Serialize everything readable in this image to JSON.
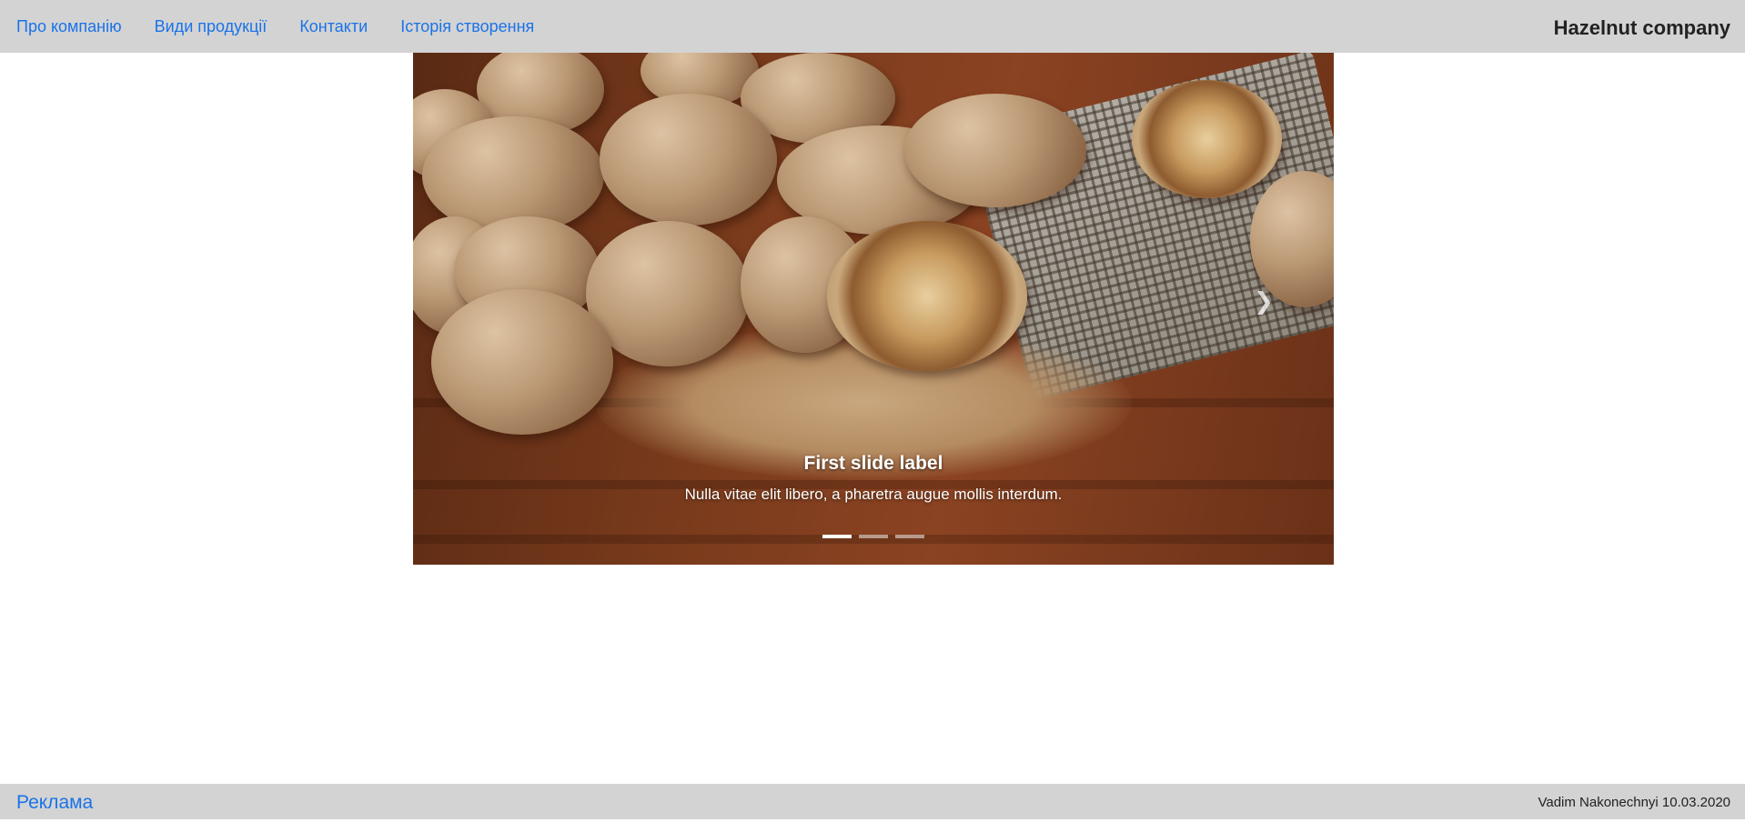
{
  "navbar": {
    "links": [
      {
        "label": "Про компанію"
      },
      {
        "label": "Види продукції"
      },
      {
        "label": "Контакти"
      },
      {
        "label": "Історія створення"
      }
    ],
    "brand": "Hazelnut company"
  },
  "carousel": {
    "active_slide": 1,
    "slide_count": 3,
    "caption_title": "First slide label",
    "caption_text": "Nulla vitae elit libero, a pharetra augue mollis interdum.",
    "next_icon": "chevron-right-icon"
  },
  "footer": {
    "link": "Реклама",
    "credit": "Vadim Nakonechnyi 10.03.2020"
  },
  "colors": {
    "bar_background": "#d3d3d3",
    "link": "#1a73e8",
    "text": "#222222"
  }
}
